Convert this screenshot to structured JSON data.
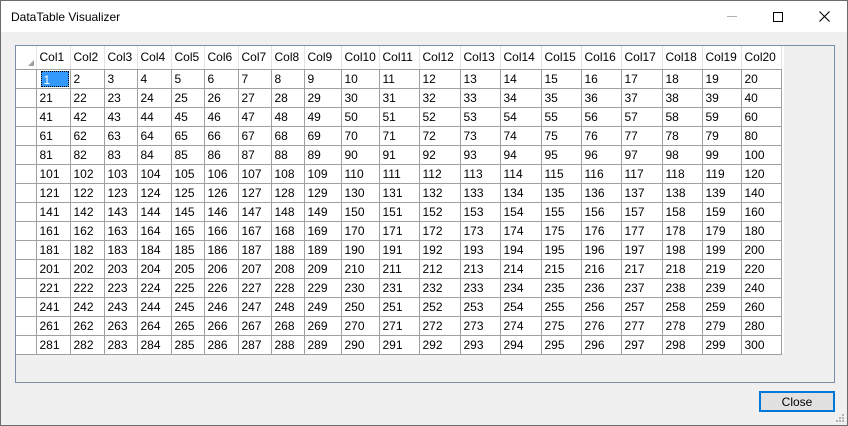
{
  "window": {
    "title": "DataTable Visualizer",
    "close_button_label": "Close"
  },
  "grid": {
    "columns": [
      "Col1",
      "Col2",
      "Col3",
      "Col4",
      "Col5",
      "Col6",
      "Col7",
      "Col8",
      "Col9",
      "Col10",
      "Col11",
      "Col12",
      "Col13",
      "Col14",
      "Col15",
      "Col16",
      "Col17",
      "Col18",
      "Col19",
      "Col20"
    ],
    "rows": [
      [
        "1",
        "2",
        "3",
        "4",
        "5",
        "6",
        "7",
        "8",
        "9",
        "10",
        "11",
        "12",
        "13",
        "14",
        "15",
        "16",
        "17",
        "18",
        "19",
        "20"
      ],
      [
        "21",
        "22",
        "23",
        "24",
        "25",
        "26",
        "27",
        "28",
        "29",
        "30",
        "31",
        "32",
        "33",
        "34",
        "35",
        "36",
        "37",
        "38",
        "39",
        "40"
      ],
      [
        "41",
        "42",
        "43",
        "44",
        "45",
        "46",
        "47",
        "48",
        "49",
        "50",
        "51",
        "52",
        "53",
        "54",
        "55",
        "56",
        "57",
        "58",
        "59",
        "60"
      ],
      [
        "61",
        "62",
        "63",
        "64",
        "65",
        "66",
        "67",
        "68",
        "69",
        "70",
        "71",
        "72",
        "73",
        "74",
        "75",
        "76",
        "77",
        "78",
        "79",
        "80"
      ],
      [
        "81",
        "82",
        "83",
        "84",
        "85",
        "86",
        "87",
        "88",
        "89",
        "90",
        "91",
        "92",
        "93",
        "94",
        "95",
        "96",
        "97",
        "98",
        "99",
        "100"
      ],
      [
        "101",
        "102",
        "103",
        "104",
        "105",
        "106",
        "107",
        "108",
        "109",
        "110",
        "111",
        "112",
        "113",
        "114",
        "115",
        "116",
        "117",
        "118",
        "119",
        "120"
      ],
      [
        "121",
        "122",
        "123",
        "124",
        "125",
        "126",
        "127",
        "128",
        "129",
        "130",
        "131",
        "132",
        "133",
        "134",
        "135",
        "136",
        "137",
        "138",
        "139",
        "140"
      ],
      [
        "141",
        "142",
        "143",
        "144",
        "145",
        "146",
        "147",
        "148",
        "149",
        "150",
        "151",
        "152",
        "153",
        "154",
        "155",
        "156",
        "157",
        "158",
        "159",
        "160"
      ],
      [
        "161",
        "162",
        "163",
        "164",
        "165",
        "166",
        "167",
        "168",
        "169",
        "170",
        "171",
        "172",
        "173",
        "174",
        "175",
        "176",
        "177",
        "178",
        "179",
        "180"
      ],
      [
        "181",
        "182",
        "183",
        "184",
        "185",
        "186",
        "187",
        "188",
        "189",
        "190",
        "191",
        "192",
        "193",
        "194",
        "195",
        "196",
        "197",
        "198",
        "199",
        "200"
      ],
      [
        "201",
        "202",
        "203",
        "204",
        "205",
        "206",
        "207",
        "208",
        "209",
        "210",
        "211",
        "212",
        "213",
        "214",
        "215",
        "216",
        "217",
        "218",
        "219",
        "220"
      ],
      [
        "221",
        "222",
        "223",
        "224",
        "225",
        "226",
        "227",
        "228",
        "229",
        "230",
        "231",
        "232",
        "233",
        "234",
        "235",
        "236",
        "237",
        "238",
        "239",
        "240"
      ],
      [
        "241",
        "242",
        "243",
        "244",
        "245",
        "246",
        "247",
        "248",
        "249",
        "250",
        "251",
        "252",
        "253",
        "254",
        "255",
        "256",
        "257",
        "258",
        "259",
        "260"
      ],
      [
        "261",
        "262",
        "263",
        "264",
        "265",
        "266",
        "267",
        "268",
        "269",
        "270",
        "271",
        "272",
        "273",
        "274",
        "275",
        "276",
        "277",
        "278",
        "279",
        "280"
      ],
      [
        "281",
        "282",
        "283",
        "284",
        "285",
        "286",
        "287",
        "288",
        "289",
        "290",
        "291",
        "292",
        "293",
        "294",
        "295",
        "296",
        "297",
        "298",
        "299",
        "300"
      ]
    ],
    "selected_cell": {
      "row": 0,
      "col": 0
    }
  },
  "icons": {
    "minimize": "minimize-icon",
    "maximize": "maximize-icon",
    "close": "close-icon",
    "resize_grip": "resize-grip-icon"
  },
  "colors": {
    "selection": "#3399ff",
    "grid_border": "#7a8fa6",
    "button_focus": "#0078d7"
  }
}
